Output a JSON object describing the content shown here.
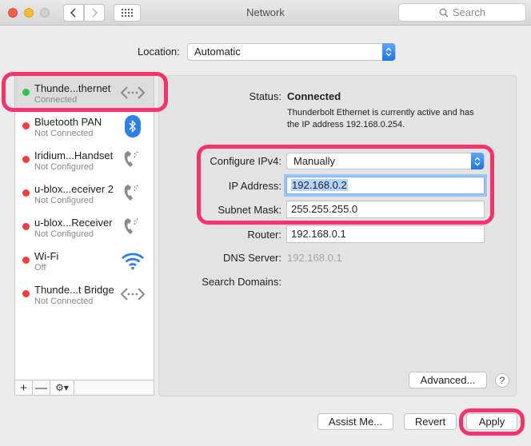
{
  "window": {
    "title": "Network"
  },
  "search": {
    "placeholder": "Search"
  },
  "location": {
    "label": "Location:",
    "value": "Automatic"
  },
  "services": [
    {
      "name": "Thunde...thernet",
      "status": "Connected",
      "state": "green",
      "icon": "ethernet-icon",
      "selected": true
    },
    {
      "name": "Bluetooth PAN",
      "status": "Not Connected",
      "state": "red",
      "icon": "bluetooth-icon"
    },
    {
      "name": "Iridium...Handset",
      "status": "Not Configured",
      "state": "red",
      "icon": "phone-icon"
    },
    {
      "name": "u-blox...eceiver 2",
      "status": "Not Configured",
      "state": "red",
      "icon": "phone-icon"
    },
    {
      "name": "u-blox...Receiver",
      "status": "Not Configured",
      "state": "red",
      "icon": "phone-icon"
    },
    {
      "name": "Wi-Fi",
      "status": "Off",
      "state": "red",
      "icon": "wifi-icon"
    },
    {
      "name": "Thunde...t Bridge",
      "status": "Not Connected",
      "state": "red",
      "icon": "ethernet-icon"
    }
  ],
  "sidebar_toolbar": {
    "add": "+",
    "remove": "—",
    "gear": "⚙▾"
  },
  "detail": {
    "status_label": "Status:",
    "status_value": "Connected",
    "status_desc": "Thunderbolt Ethernet is currently active and has the IP address 192.168.0.254.",
    "configure_label": "Configure IPv4:",
    "configure_value": "Manually",
    "ip_label": "IP Address:",
    "ip_value": "192.168.0.2",
    "subnet_label": "Subnet Mask:",
    "subnet_value": "255.255.255.0",
    "router_label": "Router:",
    "router_value": "192.168.0.1",
    "dns_label": "DNS Server:",
    "dns_value": "192.168.0.1",
    "search_domains_label": "Search Domains:"
  },
  "buttons": {
    "advanced": "Advanced...",
    "help": "?",
    "assist": "Assist Me...",
    "revert": "Revert",
    "apply": "Apply"
  },
  "colors": {
    "annotation": "#f7336c",
    "accent": "#1b74e8",
    "connected": "#2ac840",
    "disconnected": "#ee3f3a"
  }
}
